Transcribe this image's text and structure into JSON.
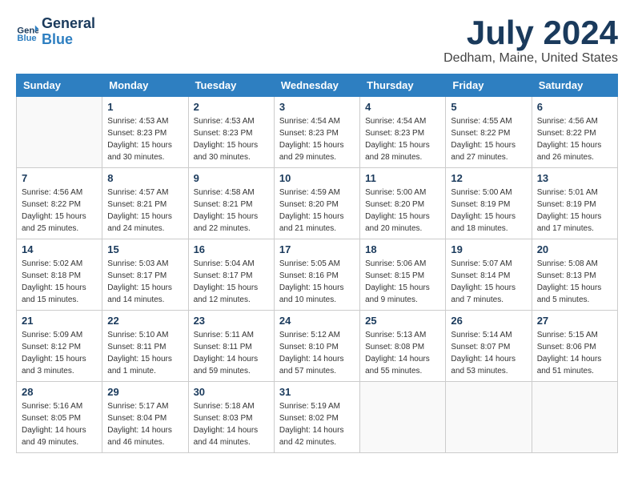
{
  "logo": {
    "line1": "General",
    "line2": "Blue"
  },
  "title": "July 2024",
  "location": "Dedham, Maine, United States",
  "weekdays": [
    "Sunday",
    "Monday",
    "Tuesday",
    "Wednesday",
    "Thursday",
    "Friday",
    "Saturday"
  ],
  "weeks": [
    [
      {
        "num": "",
        "sunrise": "",
        "sunset": "",
        "daylight": ""
      },
      {
        "num": "1",
        "sunrise": "Sunrise: 4:53 AM",
        "sunset": "Sunset: 8:23 PM",
        "daylight": "Daylight: 15 hours and 30 minutes."
      },
      {
        "num": "2",
        "sunrise": "Sunrise: 4:53 AM",
        "sunset": "Sunset: 8:23 PM",
        "daylight": "Daylight: 15 hours and 30 minutes."
      },
      {
        "num": "3",
        "sunrise": "Sunrise: 4:54 AM",
        "sunset": "Sunset: 8:23 PM",
        "daylight": "Daylight: 15 hours and 29 minutes."
      },
      {
        "num": "4",
        "sunrise": "Sunrise: 4:54 AM",
        "sunset": "Sunset: 8:23 PM",
        "daylight": "Daylight: 15 hours and 28 minutes."
      },
      {
        "num": "5",
        "sunrise": "Sunrise: 4:55 AM",
        "sunset": "Sunset: 8:22 PM",
        "daylight": "Daylight: 15 hours and 27 minutes."
      },
      {
        "num": "6",
        "sunrise": "Sunrise: 4:56 AM",
        "sunset": "Sunset: 8:22 PM",
        "daylight": "Daylight: 15 hours and 26 minutes."
      }
    ],
    [
      {
        "num": "7",
        "sunrise": "Sunrise: 4:56 AM",
        "sunset": "Sunset: 8:22 PM",
        "daylight": "Daylight: 15 hours and 25 minutes."
      },
      {
        "num": "8",
        "sunrise": "Sunrise: 4:57 AM",
        "sunset": "Sunset: 8:21 PM",
        "daylight": "Daylight: 15 hours and 24 minutes."
      },
      {
        "num": "9",
        "sunrise": "Sunrise: 4:58 AM",
        "sunset": "Sunset: 8:21 PM",
        "daylight": "Daylight: 15 hours and 22 minutes."
      },
      {
        "num": "10",
        "sunrise": "Sunrise: 4:59 AM",
        "sunset": "Sunset: 8:20 PM",
        "daylight": "Daylight: 15 hours and 21 minutes."
      },
      {
        "num": "11",
        "sunrise": "Sunrise: 5:00 AM",
        "sunset": "Sunset: 8:20 PM",
        "daylight": "Daylight: 15 hours and 20 minutes."
      },
      {
        "num": "12",
        "sunrise": "Sunrise: 5:00 AM",
        "sunset": "Sunset: 8:19 PM",
        "daylight": "Daylight: 15 hours and 18 minutes."
      },
      {
        "num": "13",
        "sunrise": "Sunrise: 5:01 AM",
        "sunset": "Sunset: 8:19 PM",
        "daylight": "Daylight: 15 hours and 17 minutes."
      }
    ],
    [
      {
        "num": "14",
        "sunrise": "Sunrise: 5:02 AM",
        "sunset": "Sunset: 8:18 PM",
        "daylight": "Daylight: 15 hours and 15 minutes."
      },
      {
        "num": "15",
        "sunrise": "Sunrise: 5:03 AM",
        "sunset": "Sunset: 8:17 PM",
        "daylight": "Daylight: 15 hours and 14 minutes."
      },
      {
        "num": "16",
        "sunrise": "Sunrise: 5:04 AM",
        "sunset": "Sunset: 8:17 PM",
        "daylight": "Daylight: 15 hours and 12 minutes."
      },
      {
        "num": "17",
        "sunrise": "Sunrise: 5:05 AM",
        "sunset": "Sunset: 8:16 PM",
        "daylight": "Daylight: 15 hours and 10 minutes."
      },
      {
        "num": "18",
        "sunrise": "Sunrise: 5:06 AM",
        "sunset": "Sunset: 8:15 PM",
        "daylight": "Daylight: 15 hours and 9 minutes."
      },
      {
        "num": "19",
        "sunrise": "Sunrise: 5:07 AM",
        "sunset": "Sunset: 8:14 PM",
        "daylight": "Daylight: 15 hours and 7 minutes."
      },
      {
        "num": "20",
        "sunrise": "Sunrise: 5:08 AM",
        "sunset": "Sunset: 8:13 PM",
        "daylight": "Daylight: 15 hours and 5 minutes."
      }
    ],
    [
      {
        "num": "21",
        "sunrise": "Sunrise: 5:09 AM",
        "sunset": "Sunset: 8:12 PM",
        "daylight": "Daylight: 15 hours and 3 minutes."
      },
      {
        "num": "22",
        "sunrise": "Sunrise: 5:10 AM",
        "sunset": "Sunset: 8:11 PM",
        "daylight": "Daylight: 15 hours and 1 minute."
      },
      {
        "num": "23",
        "sunrise": "Sunrise: 5:11 AM",
        "sunset": "Sunset: 8:11 PM",
        "daylight": "Daylight: 14 hours and 59 minutes."
      },
      {
        "num": "24",
        "sunrise": "Sunrise: 5:12 AM",
        "sunset": "Sunset: 8:10 PM",
        "daylight": "Daylight: 14 hours and 57 minutes."
      },
      {
        "num": "25",
        "sunrise": "Sunrise: 5:13 AM",
        "sunset": "Sunset: 8:08 PM",
        "daylight": "Daylight: 14 hours and 55 minutes."
      },
      {
        "num": "26",
        "sunrise": "Sunrise: 5:14 AM",
        "sunset": "Sunset: 8:07 PM",
        "daylight": "Daylight: 14 hours and 53 minutes."
      },
      {
        "num": "27",
        "sunrise": "Sunrise: 5:15 AM",
        "sunset": "Sunset: 8:06 PM",
        "daylight": "Daylight: 14 hours and 51 minutes."
      }
    ],
    [
      {
        "num": "28",
        "sunrise": "Sunrise: 5:16 AM",
        "sunset": "Sunset: 8:05 PM",
        "daylight": "Daylight: 14 hours and 49 minutes."
      },
      {
        "num": "29",
        "sunrise": "Sunrise: 5:17 AM",
        "sunset": "Sunset: 8:04 PM",
        "daylight": "Daylight: 14 hours and 46 minutes."
      },
      {
        "num": "30",
        "sunrise": "Sunrise: 5:18 AM",
        "sunset": "Sunset: 8:03 PM",
        "daylight": "Daylight: 14 hours and 44 minutes."
      },
      {
        "num": "31",
        "sunrise": "Sunrise: 5:19 AM",
        "sunset": "Sunset: 8:02 PM",
        "daylight": "Daylight: 14 hours and 42 minutes."
      },
      {
        "num": "",
        "sunrise": "",
        "sunset": "",
        "daylight": ""
      },
      {
        "num": "",
        "sunrise": "",
        "sunset": "",
        "daylight": ""
      },
      {
        "num": "",
        "sunrise": "",
        "sunset": "",
        "daylight": ""
      }
    ]
  ]
}
